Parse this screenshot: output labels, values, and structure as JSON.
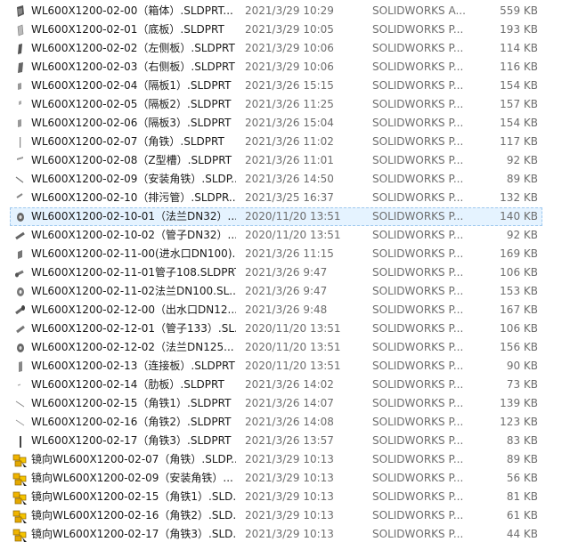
{
  "files": [
    {
      "name": "WL600X1200-02-00（箱体）.SLDPRT...",
      "date": "2021/3/29 10:29",
      "type": "SOLIDWORKS A...",
      "size": "559 KB",
      "icon": "assembly-part-icon"
    },
    {
      "name": "WL600X1200-02-01（底板）.SLDPRT",
      "date": "2021/3/29 10:05",
      "type": "SOLIDWORKS P...",
      "size": "193 KB",
      "icon": "part-thumbnail-icon"
    },
    {
      "name": "WL600X1200-02-02（左侧板）.SLDPRT",
      "date": "2021/3/29 10:06",
      "type": "SOLIDWORKS P...",
      "size": "114 KB",
      "icon": "part-thumbnail-icon"
    },
    {
      "name": "WL600X1200-02-03（右侧板）.SLDPRT",
      "date": "2021/3/29 10:06",
      "type": "SOLIDWORKS P...",
      "size": "116 KB",
      "icon": "part-thumbnail-icon"
    },
    {
      "name": "WL600X1200-02-04（隔板1）.SLDPRT",
      "date": "2021/3/26 15:15",
      "type": "SOLIDWORKS P...",
      "size": "154 KB",
      "icon": "part-thumbnail-icon"
    },
    {
      "name": "WL600X1200-02-05（隔板2）.SLDPRT",
      "date": "2021/3/26 11:25",
      "type": "SOLIDWORKS P...",
      "size": "157 KB",
      "icon": "part-thumbnail-icon"
    },
    {
      "name": "WL600X1200-02-06（隔板3）.SLDPRT",
      "date": "2021/3/26 15:04",
      "type": "SOLIDWORKS P...",
      "size": "154 KB",
      "icon": "part-thumbnail-icon"
    },
    {
      "name": "WL600X1200-02-07（角铁）.SLDPRT",
      "date": "2021/3/26 11:02",
      "type": "SOLIDWORKS P...",
      "size": "117 KB",
      "icon": "part-thumbnail-icon"
    },
    {
      "name": "WL600X1200-02-08（Z型槽）.SLDPRT",
      "date": "2021/3/26 11:01",
      "type": "SOLIDWORKS P...",
      "size": "92 KB",
      "icon": "part-thumbnail-icon"
    },
    {
      "name": "WL600X1200-02-09（安装角铁）.SLDP...",
      "date": "2021/3/26 14:50",
      "type": "SOLIDWORKS P...",
      "size": "89 KB",
      "icon": "part-thumbnail-icon"
    },
    {
      "name": "WL600X1200-02-10（排污管）.SLDPR...",
      "date": "2021/3/25 16:37",
      "type": "SOLIDWORKS P...",
      "size": "132 KB",
      "icon": "part-thumbnail-icon"
    },
    {
      "name": "WL600X1200-02-10-01（法兰DN32）....",
      "date": "2020/11/20 13:51",
      "type": "SOLIDWORKS P...",
      "size": "140 KB",
      "icon": "part-thumbnail-icon",
      "selected": true
    },
    {
      "name": "WL600X1200-02-10-02（管子DN32）....",
      "date": "2020/11/20 13:51",
      "type": "SOLIDWORKS P...",
      "size": "92 KB",
      "icon": "part-thumbnail-icon"
    },
    {
      "name": "WL600X1200-02-11-00(进水口DN100)...",
      "date": "2021/3/26 11:15",
      "type": "SOLIDWORKS P...",
      "size": "169 KB",
      "icon": "part-thumbnail-icon"
    },
    {
      "name": "WL600X1200-02-11-01管子108.SLDPRT",
      "date": "2021/3/26 9:47",
      "type": "SOLIDWORKS P...",
      "size": "106 KB",
      "icon": "part-thumbnail-icon"
    },
    {
      "name": "WL600X1200-02-11-02法兰DN100.SL...",
      "date": "2021/3/26 9:47",
      "type": "SOLIDWORKS P...",
      "size": "153 KB",
      "icon": "part-thumbnail-icon"
    },
    {
      "name": "WL600X1200-02-12-00（出水口DN12...",
      "date": "2021/3/26 9:48",
      "type": "SOLIDWORKS P...",
      "size": "167 KB",
      "icon": "part-thumbnail-icon"
    },
    {
      "name": "WL600X1200-02-12-01（管子133）.SL...",
      "date": "2020/11/20 13:51",
      "type": "SOLIDWORKS P...",
      "size": "106 KB",
      "icon": "part-thumbnail-icon"
    },
    {
      "name": "WL600X1200-02-12-02（法兰DN125...",
      "date": "2020/11/20 13:51",
      "type": "SOLIDWORKS P...",
      "size": "156 KB",
      "icon": "part-thumbnail-icon"
    },
    {
      "name": "WL600X1200-02-13（连接板）.SLDPRT",
      "date": "2020/11/20 13:51",
      "type": "SOLIDWORKS P...",
      "size": "90 KB",
      "icon": "part-thumbnail-icon"
    },
    {
      "name": "WL600X1200-02-14（肋板）.SLDPRT",
      "date": "2021/3/26 14:02",
      "type": "SOLIDWORKS P...",
      "size": "73 KB",
      "icon": "part-thumbnail-icon"
    },
    {
      "name": "WL600X1200-02-15（角铁1）.SLDPRT",
      "date": "2021/3/26 14:07",
      "type": "SOLIDWORKS P...",
      "size": "139 KB",
      "icon": "part-thumbnail-icon"
    },
    {
      "name": "WL600X1200-02-16（角铁2）.SLDPRT",
      "date": "2021/3/26 14:08",
      "type": "SOLIDWORKS P...",
      "size": "123 KB",
      "icon": "part-thumbnail-icon"
    },
    {
      "name": "WL600X1200-02-17（角铁3）.SLDPRT",
      "date": "2021/3/26 13:57",
      "type": "SOLIDWORKS P...",
      "size": "83 KB",
      "icon": "part-thumbnail-icon"
    },
    {
      "name": "镜向WL600X1200-02-07（角铁）.SLDP...",
      "date": "2021/3/29 10:13",
      "type": "SOLIDWORKS P...",
      "size": "89 KB",
      "icon": "solidworks-part-icon"
    },
    {
      "name": "镜向WL600X1200-02-09（安装角铁）...",
      "date": "2021/3/29 10:13",
      "type": "SOLIDWORKS P...",
      "size": "56 KB",
      "icon": "solidworks-part-icon"
    },
    {
      "name": "镜向WL600X1200-02-15（角铁1）.SLD...",
      "date": "2021/3/29 10:13",
      "type": "SOLIDWORKS P...",
      "size": "81 KB",
      "icon": "solidworks-part-icon"
    },
    {
      "name": "镜向WL600X1200-02-16（角铁2）.SLD...",
      "date": "2021/3/29 10:13",
      "type": "SOLIDWORKS P...",
      "size": "61 KB",
      "icon": "solidworks-part-icon"
    },
    {
      "name": "镜向WL600X1200-02-17（角铁3）.SLD...",
      "date": "2021/3/29 10:13",
      "type": "SOLIDWORKS P...",
      "size": "44 KB",
      "icon": "solidworks-part-icon"
    }
  ]
}
